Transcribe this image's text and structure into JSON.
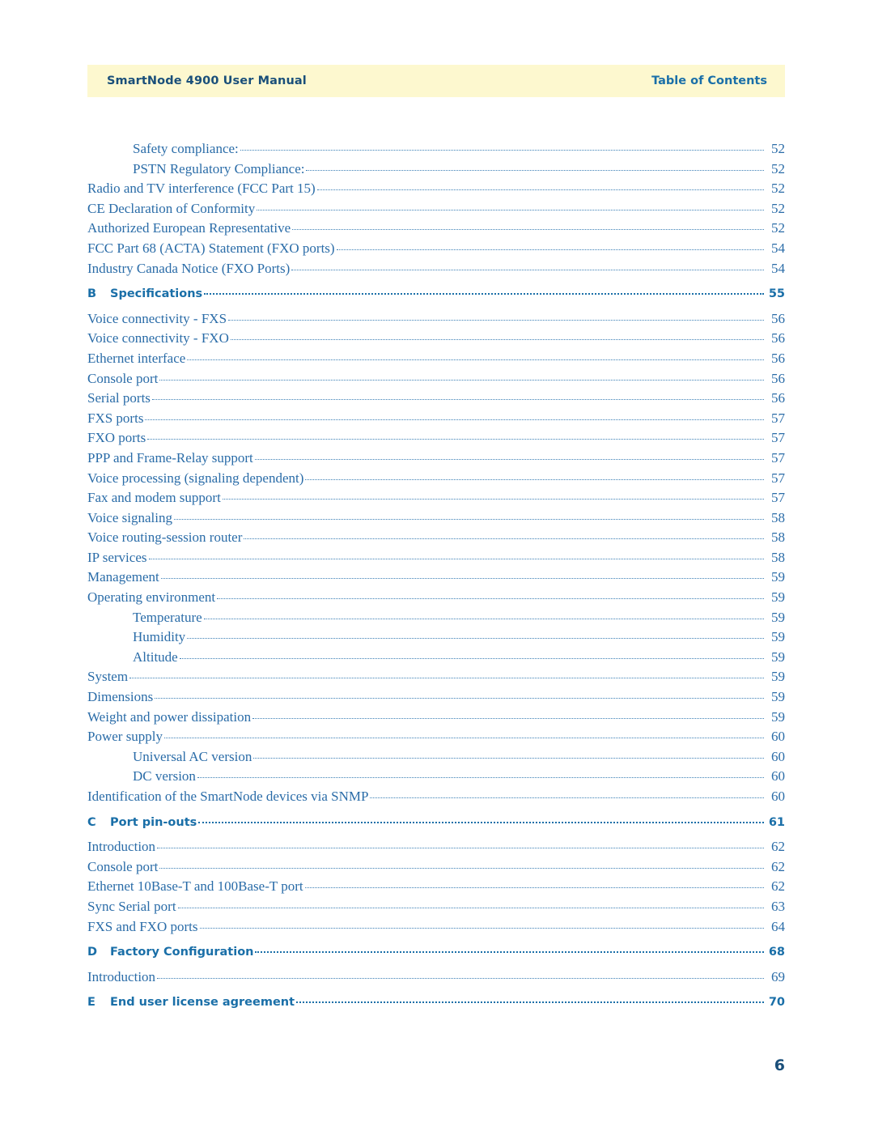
{
  "header": {
    "left": "SmartNode 4900 User Manual",
    "right": "Table of Contents"
  },
  "footer": {
    "page_number": "6"
  },
  "toc": {
    "entries": [
      {
        "letter": "",
        "label": "Safety compliance:",
        "page": "52",
        "level": 1,
        "bold": false
      },
      {
        "letter": "",
        "label": "PSTN Regulatory Compliance:",
        "page": "52",
        "level": 1,
        "bold": false
      },
      {
        "letter": "",
        "label": "Radio and TV interference (FCC Part 15)",
        "page": "52",
        "level": 0,
        "bold": false
      },
      {
        "letter": "",
        "label": "CE Declaration of Conformity",
        "page": "52",
        "level": 0,
        "bold": false
      },
      {
        "letter": "",
        "label": "Authorized European Representative",
        "page": "52",
        "level": 0,
        "bold": false
      },
      {
        "letter": "",
        "label": "FCC Part 68 (ACTA) Statement (FXO ports)",
        "page": "54",
        "level": 0,
        "bold": false
      },
      {
        "letter": "",
        "label": "Industry Canada Notice (FXO Ports)",
        "page": "54",
        "level": 0,
        "bold": false
      },
      {
        "letter": "B",
        "label": "Specifications",
        "page": "55",
        "level": 0,
        "bold": true
      },
      {
        "letter": "",
        "label": "Voice connectivity - FXS",
        "page": "56",
        "level": 0,
        "bold": false
      },
      {
        "letter": "",
        "label": "Voice connectivity - FXO",
        "page": "56",
        "level": 0,
        "bold": false
      },
      {
        "letter": "",
        "label": "Ethernet interface",
        "page": "56",
        "level": 0,
        "bold": false
      },
      {
        "letter": "",
        "label": "Console port",
        "page": "56",
        "level": 0,
        "bold": false
      },
      {
        "letter": "",
        "label": "Serial ports",
        "page": "56",
        "level": 0,
        "bold": false
      },
      {
        "letter": "",
        "label": "FXS ports",
        "page": "57",
        "level": 0,
        "bold": false
      },
      {
        "letter": "",
        "label": "FXO ports",
        "page": "57",
        "level": 0,
        "bold": false
      },
      {
        "letter": "",
        "label": "PPP and Frame-Relay support",
        "page": "57",
        "level": 0,
        "bold": false
      },
      {
        "letter": "",
        "label": "Voice processing (signaling dependent)",
        "page": "57",
        "level": 0,
        "bold": false
      },
      {
        "letter": "",
        "label": "Fax and modem support",
        "page": "57",
        "level": 0,
        "bold": false
      },
      {
        "letter": "",
        "label": "Voice signaling",
        "page": "58",
        "level": 0,
        "bold": false
      },
      {
        "letter": "",
        "label": "Voice routing-session router",
        "page": "58",
        "level": 0,
        "bold": false
      },
      {
        "letter": "",
        "label": "IP services",
        "page": "58",
        "level": 0,
        "bold": false
      },
      {
        "letter": "",
        "label": "Management",
        "page": "59",
        "level": 0,
        "bold": false
      },
      {
        "letter": "",
        "label": "Operating environment",
        "page": "59",
        "level": 0,
        "bold": false
      },
      {
        "letter": "",
        "label": "Temperature",
        "page": "59",
        "level": 1,
        "bold": false
      },
      {
        "letter": "",
        "label": "Humidity",
        "page": "59",
        "level": 1,
        "bold": false
      },
      {
        "letter": "",
        "label": "Altitude",
        "page": "59",
        "level": 1,
        "bold": false
      },
      {
        "letter": "",
        "label": "System",
        "page": "59",
        "level": 0,
        "bold": false
      },
      {
        "letter": "",
        "label": "Dimensions",
        "page": "59",
        "level": 0,
        "bold": false
      },
      {
        "letter": "",
        "label": "Weight and power dissipation",
        "page": "59",
        "level": 0,
        "bold": false
      },
      {
        "letter": "",
        "label": "Power supply",
        "page": "60",
        "level": 0,
        "bold": false
      },
      {
        "letter": "",
        "label": "Universal AC version",
        "page": "60",
        "level": 1,
        "bold": false
      },
      {
        "letter": "",
        "label": "DC version",
        "page": "60",
        "level": 1,
        "bold": false
      },
      {
        "letter": "",
        "label": "Identification of the SmartNode devices via SNMP",
        "page": "60",
        "level": 0,
        "bold": false
      },
      {
        "letter": "C",
        "label": "Port pin-outs",
        "page": "61",
        "level": 0,
        "bold": true
      },
      {
        "letter": "",
        "label": "Introduction",
        "page": "62",
        "level": 0,
        "bold": false
      },
      {
        "letter": "",
        "label": "Console port",
        "page": "62",
        "level": 0,
        "bold": false
      },
      {
        "letter": "",
        "label": "Ethernet 10Base-T and 100Base-T port",
        "page": "62",
        "level": 0,
        "bold": false
      },
      {
        "letter": "",
        "label": "Sync Serial port",
        "page": "63",
        "level": 0,
        "bold": false
      },
      {
        "letter": "",
        "label": "FXS and FXO ports",
        "page": "64",
        "level": 0,
        "bold": false
      },
      {
        "letter": "D",
        "label": "Factory Configuration",
        "page": "68",
        "level": 0,
        "bold": true
      },
      {
        "letter": "",
        "label": "Introduction",
        "page": "69",
        "level": 0,
        "bold": false
      },
      {
        "letter": "E",
        "label": "End user license agreement",
        "page": "70",
        "level": 0,
        "bold": true
      }
    ]
  },
  "colors": {
    "header_band": "#fdf8cf",
    "link_blue": "#2a6ca8",
    "heading_blue": "#1a6fa8"
  }
}
